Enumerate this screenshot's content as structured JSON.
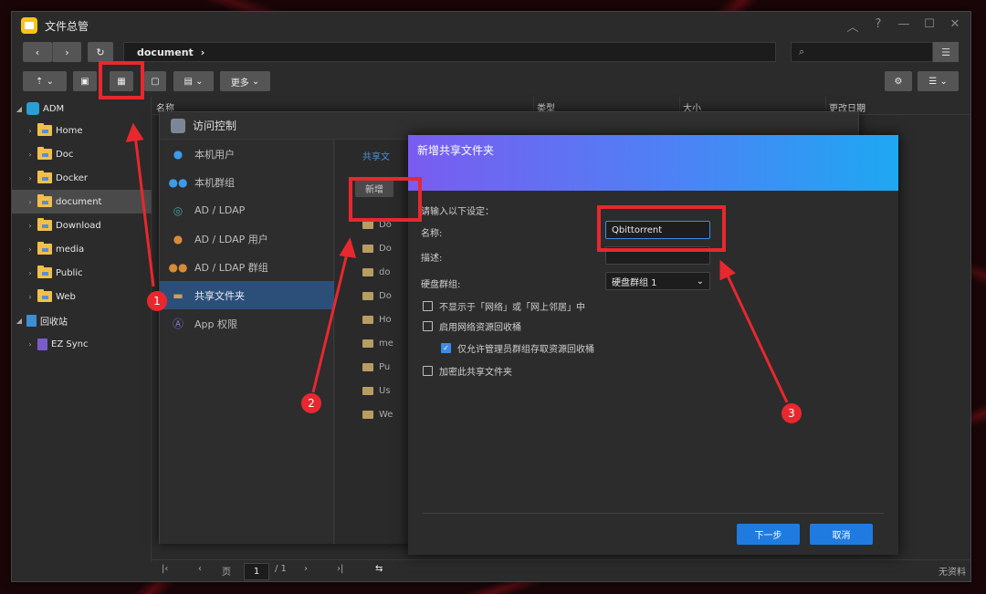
{
  "window": {
    "title": "文件总管",
    "controls": [
      "︿",
      "?",
      "—",
      "☐",
      "✕"
    ]
  },
  "nav": {
    "path": "document",
    "path_arrow": "›"
  },
  "toolbar": {
    "more_label": "更多"
  },
  "sidebar": {
    "root": "ADM",
    "items": [
      "Home",
      "Doc",
      "Docker",
      "document",
      "Download",
      "media",
      "Public",
      "Web"
    ],
    "recycle": "回收站",
    "recycle_child": "EZ Sync"
  },
  "columns": [
    "名称",
    "类型",
    "大小",
    "更改日期"
  ],
  "status": {
    "page_label": "页",
    "page_value": "1",
    "page_total": "/ 1",
    "empty_text": "无资料"
  },
  "access_control": {
    "title": "访问控制",
    "menu": [
      "本机用户",
      "本机群组",
      "AD / LDAP",
      "AD / LDAP 用户",
      "AD / LDAP 群组",
      "共享文件夹",
      "App 权限"
    ],
    "tab": "共享文",
    "new_button": "新增",
    "rows": [
      "Do",
      "Do",
      "do",
      "Do",
      "Ho",
      "me",
      "Pu",
      "Us",
      "We"
    ]
  },
  "dialog": {
    "title": "新增共享文件夹",
    "prompt": "请输入以下设定：",
    "name_label": "名称:",
    "name_value": "Qbittorrent",
    "desc_label": "描述:",
    "volume_label": "硬盘群组:",
    "volume_value": "硬盘群组 1",
    "check1": "不显示于「网络」或「网上邻居」中",
    "check2": "启用网络资源回收桶",
    "check3": "仅允许管理员群组存取资源回收桶",
    "check4": "加密此共享文件夹",
    "next_button": "下一步",
    "cancel_button": "取消"
  },
  "annotations": [
    "1",
    "2",
    "3"
  ],
  "colors": {
    "accent": "#1f7be0",
    "annotation": "#e8282e",
    "selected_menu": "#2c4f7a"
  }
}
